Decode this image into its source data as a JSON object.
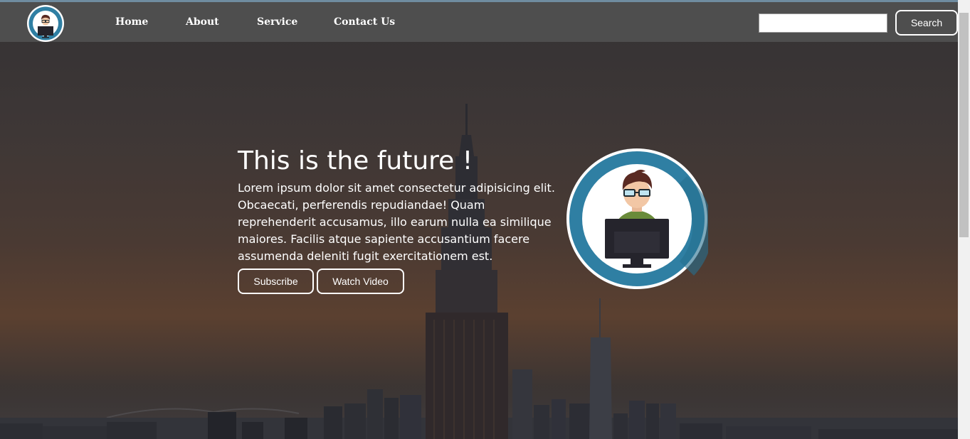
{
  "nav": {
    "logo_icon": "developer-avatar-icon",
    "links": [
      "Home",
      "About",
      "Service",
      "Contact Us"
    ],
    "search": {
      "value": "",
      "placeholder": "",
      "button_label": "Search"
    }
  },
  "hero": {
    "title": "This is the future !",
    "text": "Lorem ipsum dolor sit amet consectetur adipisicing elit. Obcaecati, perferendis repudiandae! Quam reprehenderit accusamus, illo earum nulla ea similique maiores. Facilis atque sapiente accusantium facere assumenda deleniti fugit exercitationem est.",
    "buttons": {
      "subscribe": "Subscribe",
      "watch_video": "Watch Video"
    },
    "avatar_icon": "developer-at-computer-icon"
  },
  "colors": {
    "navbar": "#4e4e4e",
    "accent_ring": "#2f7fa3",
    "text": "#ffffff"
  },
  "background_icon": "city-skyline-image"
}
